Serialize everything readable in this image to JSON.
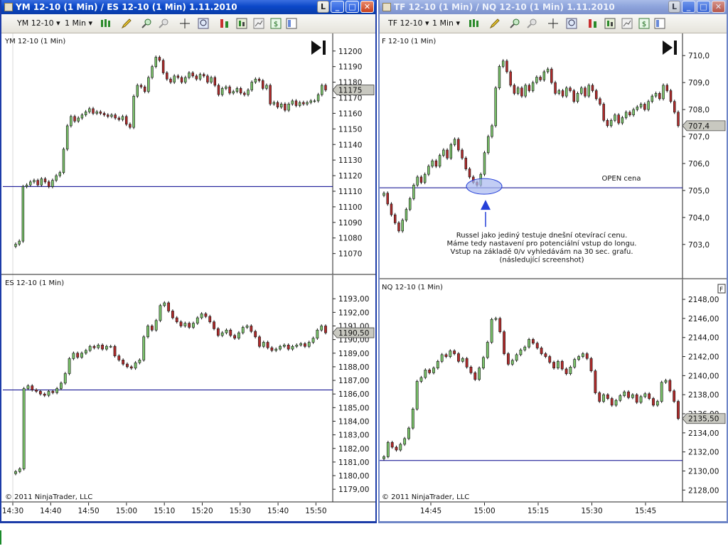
{
  "left_window": {
    "title": "YM 12-10 (1 Min) / ES 12-10 (1 Min)  1.11.2010",
    "toolbar": {
      "instrument": "YM 12-10",
      "interval": "1 Min"
    },
    "buttons": {
      "l": "L",
      "minimize": "_",
      "maximize": "□",
      "close": "✕"
    }
  },
  "right_window": {
    "title": "TF 12-10 (1 Min) / NQ 12-10 (1 Min)  1.11.2010",
    "toolbar": {
      "instrument": "TF 12-10",
      "interval": "1 Min"
    },
    "buttons": {
      "l": "L",
      "minimize": "_",
      "maximize": "□",
      "close": "✕"
    }
  },
  "colors": {
    "up": "#7bc36b",
    "down": "#b22b2b",
    "line": "#00008b",
    "ellipse": "#a8b8f0",
    "arrow": "#2540d8"
  },
  "chart_data": [
    {
      "type": "candlestick",
      "window": "left",
      "title": "YM 12-10 (1 Min)",
      "ylim": [
        11063,
        11204
      ],
      "yticks": [
        "11200",
        "11190",
        "11180",
        "11170",
        "11160",
        "11150",
        "11140",
        "11130",
        "11120",
        "11110",
        "11100",
        "11090",
        "11080",
        "11070"
      ],
      "last_price": "11175",
      "open_line": 11113,
      "copyright": "",
      "closes": [
        11076,
        11078,
        11113,
        11114,
        11116,
        11117,
        11114,
        11118,
        11116,
        11113,
        11117,
        11120,
        11122,
        11137,
        11152,
        11158,
        11155,
        11157,
        11159,
        11161,
        11163,
        11160,
        11161,
        11160,
        11159,
        11158,
        11159,
        11157,
        11156,
        11158,
        11153,
        11151,
        11171,
        11178,
        11177,
        11174,
        11183,
        11190,
        11196,
        11194,
        11186,
        11182,
        11180,
        11184,
        11183,
        11180,
        11183,
        11186,
        11184,
        11182,
        11185,
        11184,
        11180,
        11183,
        11178,
        11172,
        11176,
        11177,
        11173,
        11174,
        11176,
        11173,
        11172,
        11175,
        11180,
        11182,
        11181,
        11176,
        11178,
        11166,
        11167,
        11164,
        11166,
        11162,
        11166,
        11168,
        11165,
        11167,
        11166,
        11167,
        11168,
        11168,
        11172,
        11178,
        11175
      ]
    },
    {
      "type": "candlestick",
      "window": "left",
      "title": "ES 12-10 (1 Min)",
      "ylim": [
        1178.8,
        1193.9
      ],
      "yticks": [
        "1193,00",
        "1192,00",
        "1191,00",
        "1190,00",
        "1189,00",
        "1188,00",
        "1187,00",
        "1186,00",
        "1185,00",
        "1184,00",
        "1183,00",
        "1182,00",
        "1181,00",
        "1180,00",
        "1179,00"
      ],
      "last_price": "1190,50",
      "open_line": 1186.3,
      "copyright": "© 2011 NinjaTrader, LLC",
      "xticks": [
        "14:30",
        "14:40",
        "14:50",
        "15:00",
        "15:10",
        "15:20",
        "15:30",
        "15:40",
        "15:50"
      ],
      "closes": [
        1180.3,
        1180.5,
        1186.4,
        1186.6,
        1186.3,
        1186.2,
        1186.0,
        1185.9,
        1186.2,
        1186.1,
        1186.4,
        1186.8,
        1187.5,
        1188.6,
        1189.0,
        1188.7,
        1189.0,
        1189.2,
        1189.5,
        1189.4,
        1189.6,
        1189.3,
        1189.5,
        1189.5,
        1188.8,
        1188.5,
        1188.2,
        1188.0,
        1187.9,
        1188.3,
        1188.5,
        1190.2,
        1191.0,
        1190.7,
        1191.4,
        1192.5,
        1192.7,
        1192.1,
        1191.6,
        1191.3,
        1191.0,
        1191.2,
        1190.9,
        1191.2,
        1191.6,
        1191.9,
        1191.7,
        1191.3,
        1190.8,
        1190.3,
        1190.5,
        1190.7,
        1190.3,
        1190.1,
        1190.5,
        1190.9,
        1191.0,
        1190.6,
        1190.2,
        1189.5,
        1189.8,
        1189.4,
        1189.2,
        1189.3,
        1189.5,
        1189.6,
        1189.3,
        1189.5,
        1189.6,
        1189.7,
        1189.5,
        1189.8,
        1190.1,
        1190.7,
        1191.0,
        1190.5
      ]
    },
    {
      "type": "candlestick",
      "window": "right",
      "title": "F 12-10 (1 Min)",
      "ylim": [
        702.1,
        710.4
      ],
      "yticks": [
        "710,0",
        "709,0",
        "708,0",
        "707,0",
        "706,0",
        "705,0",
        "704,0",
        "703,0"
      ],
      "last_price": "707,4",
      "open_line": 705.1,
      "annotation_label": "OPEN cena",
      "annotation_text": [
        "Russel jako jediný testuje dnešní otevírací cenu.",
        "Máme tedy nastavení pro potenciální vstup do longu.",
        "Vstup na základě 0/v vyhledávám na 30 sec. grafu.",
        "(následující screenshot)"
      ],
      "copyright": "",
      "closes": [
        704.9,
        704.5,
        704.1,
        703.8,
        703.5,
        703.9,
        704.3,
        704.7,
        705.2,
        705.5,
        705.3,
        705.6,
        705.9,
        706.1,
        705.9,
        706.3,
        706.5,
        706.2,
        706.7,
        706.9,
        706.5,
        706.2,
        705.8,
        705.5,
        705.3,
        705.2,
        705.6,
        706.4,
        707.0,
        707.4,
        708.8,
        709.6,
        709.8,
        709.4,
        708.9,
        708.6,
        708.8,
        708.5,
        708.9,
        708.7,
        709.0,
        709.2,
        709.1,
        709.4,
        709.5,
        709.0,
        708.6,
        708.7,
        708.5,
        708.8,
        708.7,
        708.3,
        708.6,
        708.8,
        708.5,
        708.9,
        708.7,
        708.4,
        708.2,
        707.6,
        707.4,
        707.6,
        707.8,
        707.5,
        707.7,
        707.9,
        707.8,
        708.0,
        708.1,
        708.2,
        708.0,
        708.3,
        708.5,
        708.6,
        708.4,
        708.9,
        708.7,
        708.3,
        707.9,
        707.4
      ]
    },
    {
      "type": "candlestick",
      "window": "right",
      "title": "NQ 12-10 (1 Min)",
      "ylim": [
        2127.8,
        2148.9
      ],
      "yticks": [
        "2148,00",
        "2146,00",
        "2144,00",
        "2142,00",
        "2140,00",
        "2138,00",
        "2136,00",
        "2134,00",
        "2132,00",
        "2130,00",
        "2128,00"
      ],
      "last_price": "2135,50",
      "open_line": 2131.1,
      "copyright": "© 2011 NinjaTrader, LLC",
      "xticks": [
        "14:45",
        "15:00",
        "15:15",
        "15:30",
        "15:45"
      ],
      "closes": [
        2131.5,
        2133.0,
        2132.5,
        2132.2,
        2132.8,
        2133.4,
        2134.5,
        2136.5,
        2139.4,
        2139.8,
        2140.6,
        2140.3,
        2140.8,
        2141.5,
        2142.2,
        2142.0,
        2142.6,
        2142.3,
        2141.5,
        2141.8,
        2140.9,
        2140.3,
        2139.6,
        2140.8,
        2141.9,
        2143.5,
        2145.9,
        2146.0,
        2144.6,
        2142.3,
        2141.2,
        2141.6,
        2142.2,
        2142.7,
        2143.0,
        2143.8,
        2143.4,
        2142.9,
        2142.3,
        2142.0,
        2141.4,
        2140.8,
        2141.5,
        2140.7,
        2140.2,
        2140.9,
        2141.7,
        2142.0,
        2142.3,
        2141.8,
        2140.5,
        2138.2,
        2137.3,
        2138.0,
        2137.6,
        2136.9,
        2137.4,
        2137.9,
        2138.3,
        2137.7,
        2138.0,
        2137.2,
        2137.8,
        2138.1,
        2137.6,
        2136.9,
        2137.3,
        2139.3,
        2139.5,
        2138.4,
        2137.3,
        2135.5
      ]
    }
  ]
}
